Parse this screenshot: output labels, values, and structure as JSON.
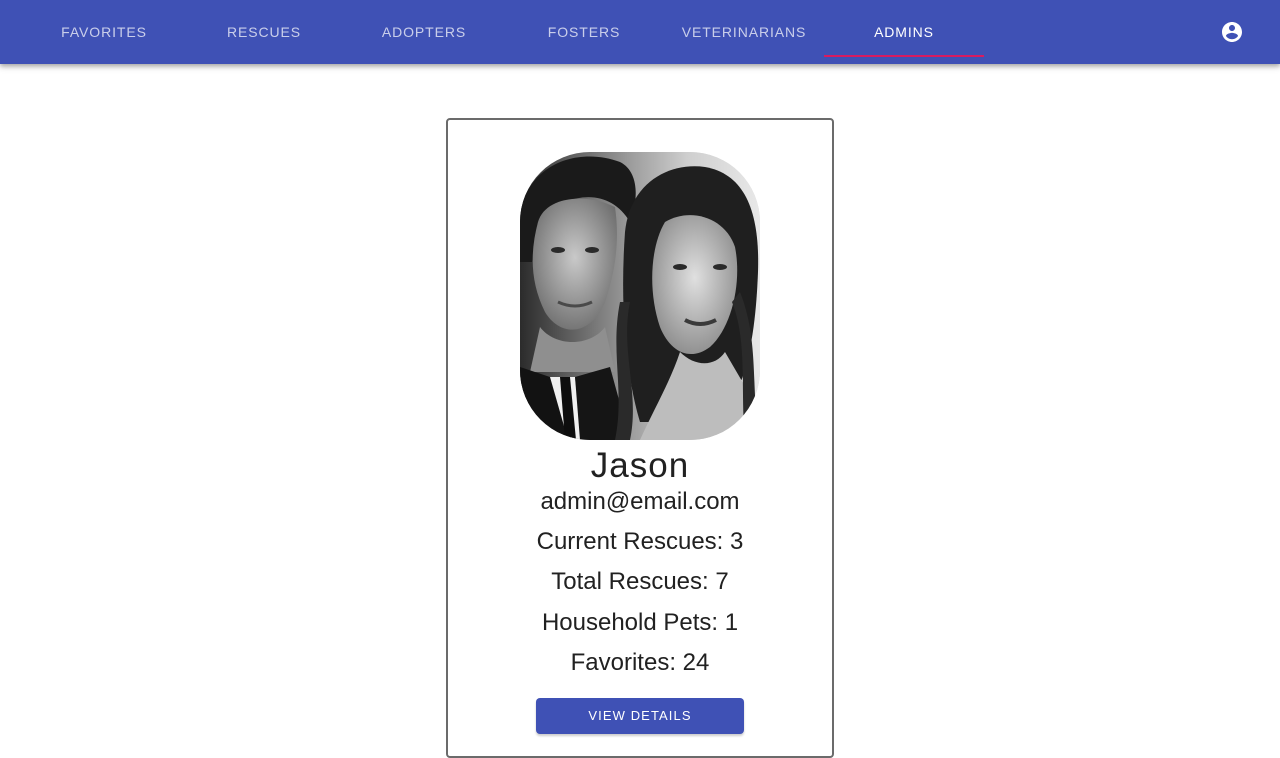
{
  "nav": {
    "tabs": [
      {
        "label": "FAVORITES",
        "active": false
      },
      {
        "label": "RESCUES",
        "active": false
      },
      {
        "label": "ADOPTERS",
        "active": false
      },
      {
        "label": "FOSTERS",
        "active": false
      },
      {
        "label": "VETERINARIANS",
        "active": false
      },
      {
        "label": "ADMINS",
        "active": true
      }
    ],
    "account_icon": "account-circle-icon"
  },
  "card": {
    "photo_icon": "profile-photo",
    "name": "Jason",
    "email": "admin@email.com",
    "stats": [
      "Current Rescues: 3",
      "Total Rescues: 7",
      "Household Pets: 1",
      "Favorites: 24"
    ],
    "button_label": "VIEW DETAILS"
  },
  "colors": {
    "primary": "#3f51b5",
    "accent": "#d81b60",
    "text": "#212121"
  }
}
